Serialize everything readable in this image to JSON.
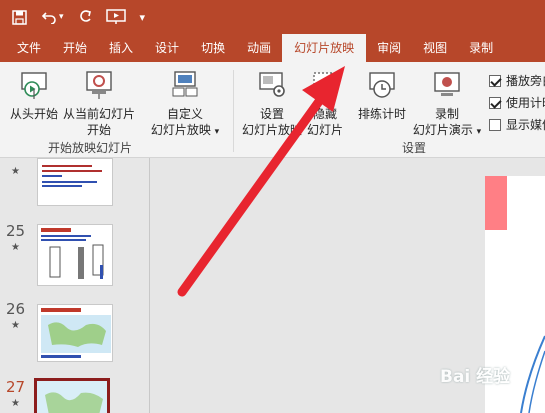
{
  "tabs": [
    {
      "label": "文件",
      "active": false
    },
    {
      "label": "开始",
      "active": false
    },
    {
      "label": "插入",
      "active": false
    },
    {
      "label": "设计",
      "active": false
    },
    {
      "label": "切换",
      "active": false
    },
    {
      "label": "动画",
      "active": false
    },
    {
      "label": "幻灯片放映",
      "active": true
    },
    {
      "label": "审阅",
      "active": false
    },
    {
      "label": "视图",
      "active": false
    },
    {
      "label": "录制",
      "active": false
    }
  ],
  "ribbon": {
    "from_beginning_label": "从头开始",
    "from_current_line1": "从当前幻灯片",
    "from_current_line2": "开始",
    "custom_line1": "自定义",
    "custom_line2": "幻灯片放映",
    "group_start_label": "开始放映幻灯片",
    "setup_line1": "设置",
    "setup_line2": "幻灯片放映",
    "hide_line1": "隐藏",
    "hide_line2": "幻灯片",
    "rehearse_label": "排练计时",
    "record_line1": "录制",
    "record_line2": "幻灯片演示",
    "group_setup_label": "设置",
    "play_narration_label": "播放旁白",
    "use_timings_label": "使用计时",
    "show_media_label": "显示媒体"
  },
  "checkboxes": {
    "play_narration": true,
    "use_timings": true,
    "show_media": false
  },
  "thumbnails": [
    {
      "number": "",
      "star": "★"
    },
    {
      "number": "25",
      "star": "★"
    },
    {
      "number": "26",
      "star": "★"
    },
    {
      "number": "27",
      "star": "★"
    }
  ],
  "watermark": "Bai  经验",
  "colors": {
    "accent": "#b7472a",
    "arrow": "#e8252f",
    "selected_border": "#8c1d1d"
  }
}
